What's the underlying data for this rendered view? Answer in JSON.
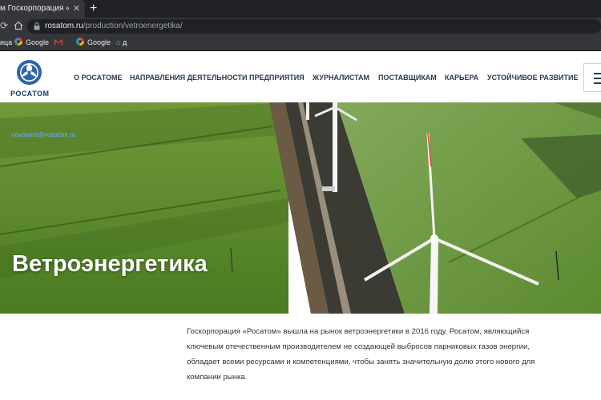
{
  "browser": {
    "tab_title": "м Госкорпорация «Росат",
    "tab_close": "✕",
    "new_tab": "+",
    "url_host": "rosatom.ru",
    "url_path": "/production/vetroenergetika/",
    "bookmarks": [
      {
        "label": "ица"
      },
      {
        "label": "Google"
      },
      {
        "label": ""
      },
      {
        "label": "Google"
      },
      {
        "label": "д"
      }
    ]
  },
  "site": {
    "logo_text": "РОСАТОМ",
    "nav": [
      "О РОСАТОМЕ",
      "НАПРАВЛЕНИЯ ДЕЯТЕЛЬНОСТИ",
      "ПРЕДПРИЯТИЯ",
      "ЖУРНАЛИСТАМ",
      "ПОСТАВЩИКАМ",
      "КАРЬЕРА",
      "УСТОЙЧИВОЕ РАЗВИТИЕ"
    ]
  },
  "hero": {
    "email": "novawind@rosatom.ru",
    "title": "Ветроэнергетика"
  },
  "intro": {
    "text": "Госкорпорация «Росатом» вышла на рынок ветроэнергетики в 2016 году. Росатом, являющийся ключевым отечественным производителем не создающей выбросов парниковых газов энергии, обладает всеми ресурсами и компетенциями, чтобы занять значительную долю этого нового для компании рынка."
  },
  "colors": {
    "chrome_dark": "#202124",
    "chrome_mid": "#35363a",
    "brand_blue": "#123a6b",
    "field_green": "#5e8a2e"
  }
}
